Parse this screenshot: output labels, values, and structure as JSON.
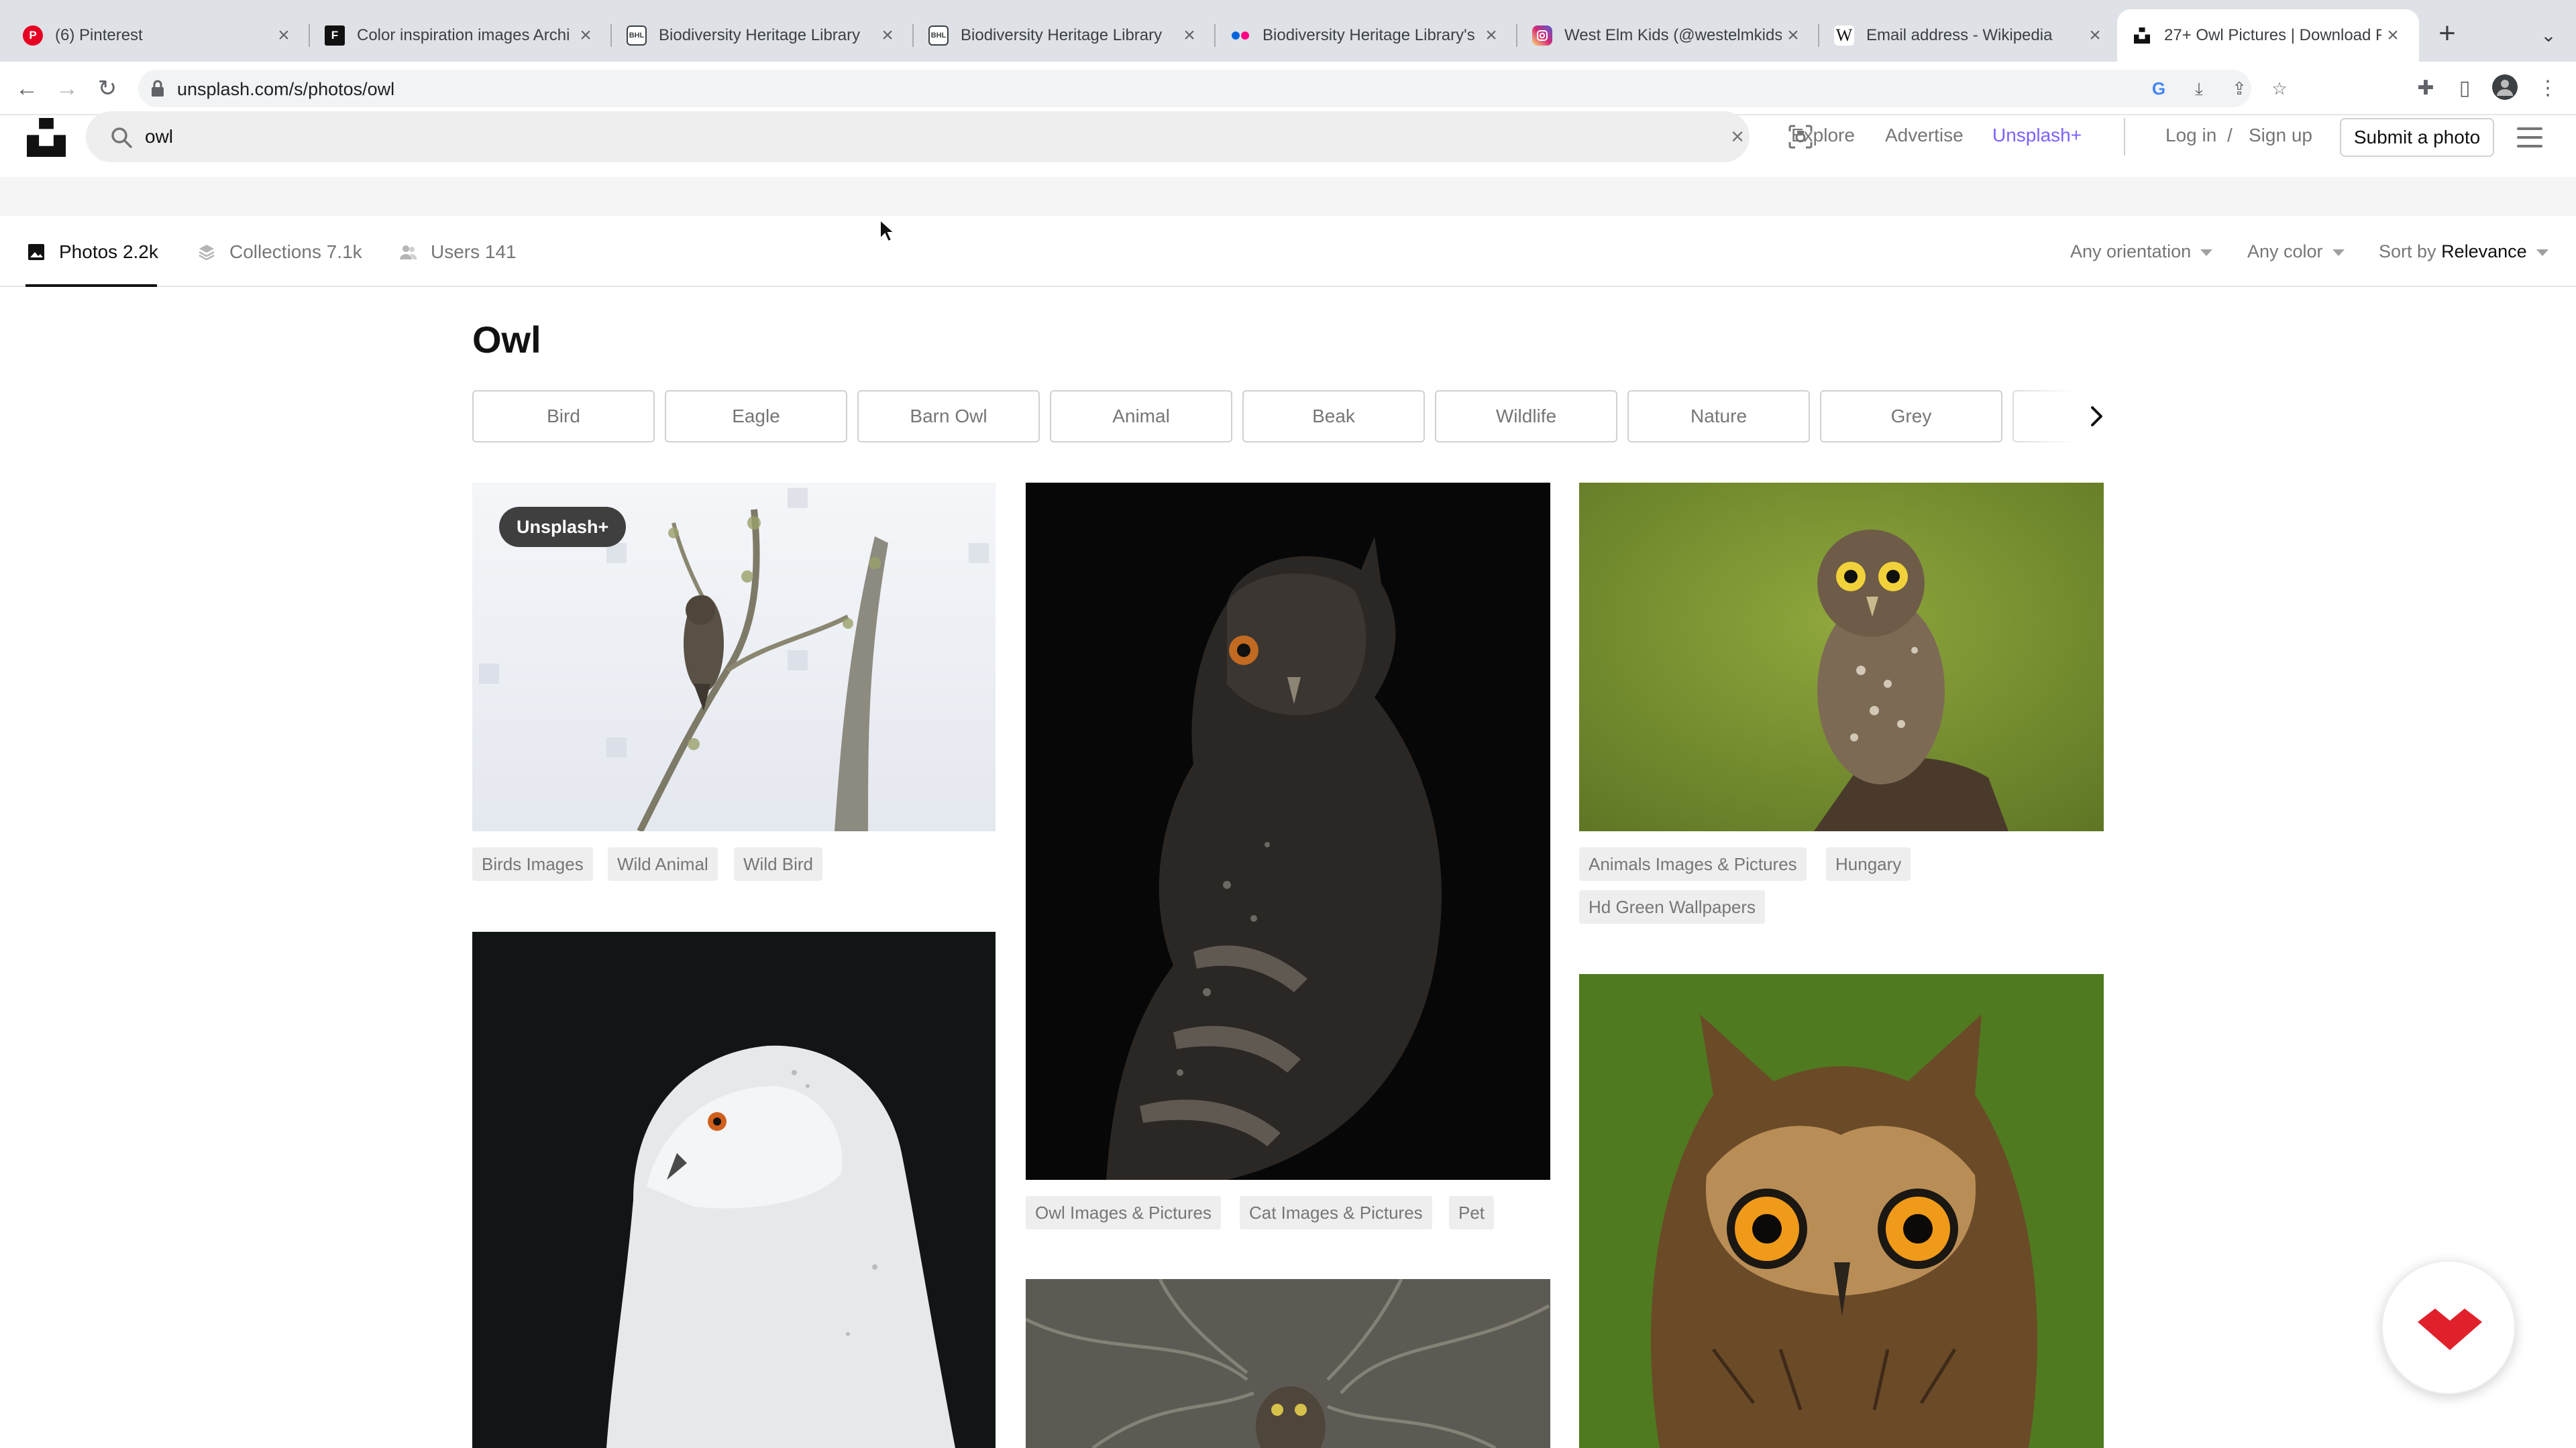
{
  "browser": {
    "tabs": [
      {
        "title": "(6) Pinterest",
        "favicon": "pinterest-icon",
        "color": "#e60023"
      },
      {
        "title": "Color inspiration images Archi",
        "favicon": "fab-icon",
        "color": "#111111"
      },
      {
        "title": "Biodiversity Heritage Library",
        "favicon": "bhl-icon",
        "color": "#3c4043"
      },
      {
        "title": "Biodiversity Heritage Library",
        "favicon": "bhl-icon",
        "color": "#3c4043"
      },
      {
        "title": "Biodiversity Heritage Library's",
        "favicon": "flickr-icon",
        "color": "#0063dc"
      },
      {
        "title": "West Elm Kids (@westelmkids)",
        "favicon": "instagram-icon",
        "color": "#d62976"
      },
      {
        "title": "Email address - Wikipedia",
        "favicon": "wikipedia-icon",
        "color": "#ffffff"
      },
      {
        "title": "27+ Owl Pictures | Download F",
        "favicon": "unsplash-icon",
        "color": "#111111",
        "active": true
      }
    ],
    "url": "unsplash.com/s/photos/owl"
  },
  "header": {
    "search_query": "owl",
    "nav": {
      "explore": "Explore",
      "advertise": "Advertise",
      "unsplash_plus": "Unsplash+"
    },
    "login": "Log in",
    "separator": "/",
    "signup": "Sign up",
    "submit": "Submit a photo"
  },
  "subnav": {
    "tabs": [
      {
        "label": "Photos 2.2k",
        "active": true
      },
      {
        "label": "Collections 7.1k"
      },
      {
        "label": "Users 141"
      }
    ],
    "filters": {
      "orientation": "Any orientation",
      "color": "Any color",
      "sort_prefix": "Sort by",
      "sort_value": "Relevance"
    }
  },
  "main": {
    "title": "Owl",
    "related": [
      "Bird",
      "Eagle",
      "Barn Owl",
      "Animal",
      "Beak",
      "Wildlife",
      "Nature",
      "Grey"
    ],
    "plus_badge": "Unsplash+",
    "photos": [
      {
        "subject": "owl-on-branch-winter",
        "tags": [
          "Birds Images",
          "Wild Animal",
          "Wild Bird"
        ]
      },
      {
        "subject": "scops-owl-dark",
        "tags": [
          "Owl Images & Pictures",
          "Cat Images & Pictures",
          "Pet"
        ]
      },
      {
        "subject": "little-owl-green",
        "tags": [
          "Animals Images & Pictures",
          "Hungary",
          "Hd Green Wallpapers"
        ]
      },
      {
        "subject": "snowy-owl"
      },
      {
        "subject": "owl-in-branches"
      },
      {
        "subject": "eagle-owl-closeup"
      }
    ]
  },
  "colors": {
    "accent_plus": "#7b61ff",
    "fab_red": "#e0202b"
  }
}
